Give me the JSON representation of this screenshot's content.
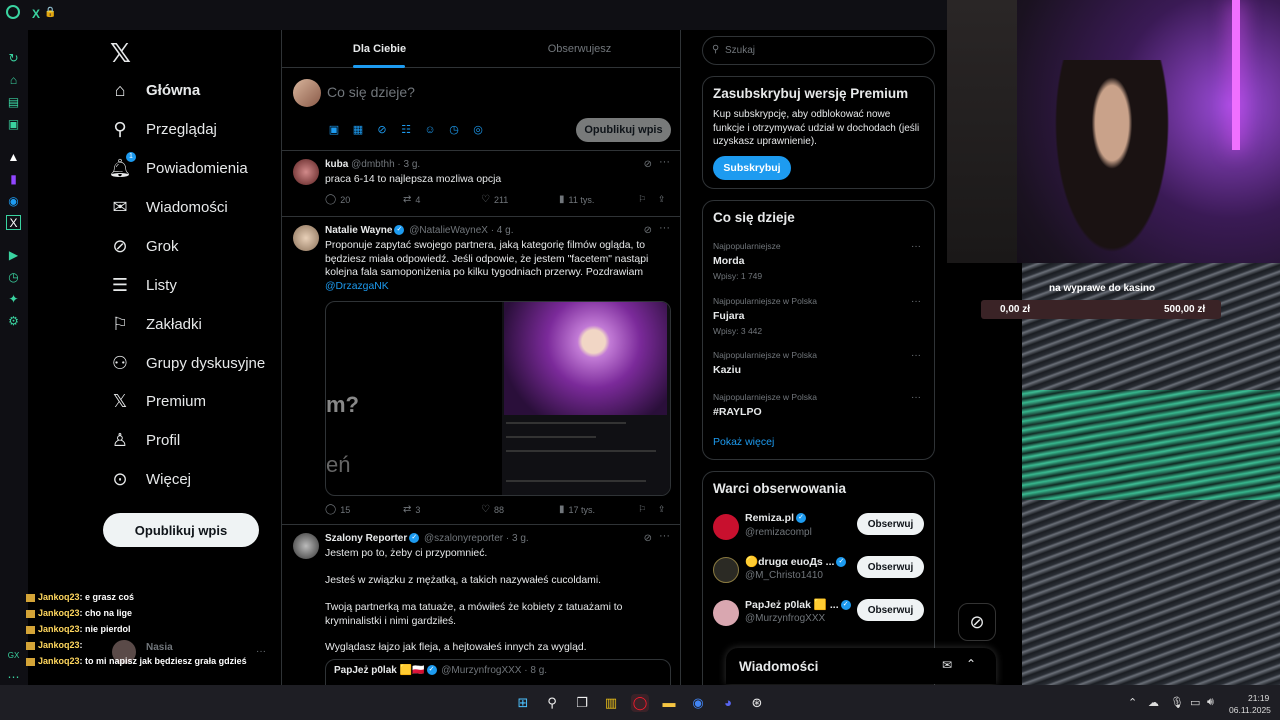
{
  "browser": {
    "tab_x": "X"
  },
  "nav": {
    "items": [
      {
        "label": "Główna",
        "icon": "home-icon"
      },
      {
        "label": "Przeglądaj",
        "icon": "search-icon"
      },
      {
        "label": "Powiadomienia",
        "icon": "bell-icon",
        "badge": "1"
      },
      {
        "label": "Wiadomości",
        "icon": "mail-icon"
      },
      {
        "label": "Grok",
        "icon": "grok-icon"
      },
      {
        "label": "Listy",
        "icon": "list-icon"
      },
      {
        "label": "Zakładki",
        "icon": "bookmark-icon"
      },
      {
        "label": "Grupy dyskusyjne",
        "icon": "people-icon"
      },
      {
        "label": "Premium",
        "icon": "x-logo-icon"
      },
      {
        "label": "Profil",
        "icon": "person-icon"
      },
      {
        "label": "Więcej",
        "icon": "more-circle-icon"
      }
    ],
    "post_button": "Opublikuj wpis"
  },
  "chat": [
    {
      "user": "Jankoq23",
      "msg": ": e grasz coś"
    },
    {
      "user": "Jankoq23",
      "msg": ": cho na lige"
    },
    {
      "user": "Jankoq23",
      "msg": ": nie pierdol"
    },
    {
      "user": "Jankoq23",
      "msg": ": "
    },
    {
      "user": "Jankoq23",
      "msg": ": to mi napisz jak będziesz grała gdzieś"
    }
  ],
  "chat_popup_name": "Nasia",
  "timeline": {
    "tabs": [
      "Dla Ciebie",
      "Obserwujesz"
    ],
    "compose_placeholder": "Co się dzieje?",
    "compose_post": "Opublikuj wpis",
    "tweets": [
      {
        "name": "kuba",
        "handle": "@dmbthh",
        "time": "· 3 g.",
        "text": "praca 6-14 to najlepsza mozliwa opcja",
        "replies": "20",
        "retweets": "4",
        "likes": "211",
        "views": "11 tys."
      },
      {
        "name": "Natalie Wayne",
        "handle": "@NatalieWayneX",
        "time": "· 4 g.",
        "text": "Proponuje zapytać swojego partnera, jaką kategorię filmów ogląda, to będziesz miała odpowiedź. Jeśli odpowie, że jestem \"facetem\" nastąpi kolejna fala samoponiżenia po kilku tygodniach przerwy. Pozdrawiam",
        "mention": "@DrzazgaNK",
        "media_text_1": "m?",
        "media_text_2": "eń",
        "replies": "15",
        "retweets": "3",
        "likes": "88",
        "views": "17 tys."
      },
      {
        "name": "Szalony Reporter",
        "handle": "@szalonyreporter",
        "time": "· 3 g.",
        "lines": [
          "Jestem po to, żeby ci przypomnieć.",
          "Jesteś w związku z mężatką, a takich nazywałeś cucoldami.",
          "Twoją partnerką ma tatuaże, a mówiłeś że kobiety z tatuażami to kryminalistki i nimi gardziłeś.",
          "Wyglądasz łajzo jak fleja, a hejtowałeś innych za wygląd."
        ],
        "quote_name": "PapJeż p0lak 🟨🇵🇱",
        "quote_handle": "@MurzynfrogXXX",
        "quote_time": "· 8 g."
      }
    ]
  },
  "right": {
    "search_placeholder": "Szukaj",
    "premium": {
      "title": "Zasubskrybuj wersję Premium",
      "desc": "Kup subskrypcję, aby odblokować nowe funkcje i otrzymywać udział w dochodach (jeśli uzyskasz uprawnienie).",
      "button": "Subskrybuj"
    },
    "trends": {
      "title": "Co się dzieje",
      "items": [
        {
          "context": "Najpopularniejsze",
          "name": "Morda",
          "count": "Wpisy: 1 749"
        },
        {
          "context": "Najpopularniejsze w Polska",
          "name": "Fujara",
          "count": "Wpisy: 3 442"
        },
        {
          "context": "Najpopularniejsze w Polska",
          "name": "Kaziu",
          "count": ""
        },
        {
          "context": "Najpopularniejsze w Polska",
          "name": "#RAYLPO",
          "count": ""
        }
      ],
      "show_more": "Pokaż więcej"
    },
    "follow": {
      "title": "Warci obserwowania",
      "items": [
        {
          "name": "Remiza.pl",
          "handle": "@remizacompl",
          "button": "Obserwuj",
          "color": "#c8102e"
        },
        {
          "name": "🟡drugα euoДs ...",
          "handle": "@M_Christo1410",
          "button": "Obserwuj",
          "color": "#2b2a24"
        },
        {
          "name": "PapJeż p0lak 🟨 ...",
          "handle": "@MurzynfrogXXX",
          "button": "Obserwuj",
          "color": "#d9a7b0"
        }
      ]
    },
    "messages_title": "Wiadomości"
  },
  "stream": {
    "overlay_label": "na wyprawe do kasino",
    "goal_current": "0,00 zł",
    "goal_target": "500,00 zł"
  },
  "taskbar": {
    "time": "21:19",
    "date": "06.11.2025"
  },
  "colors": {
    "accent": "#1d9bf0",
    "opera": "#3ad3a0"
  }
}
